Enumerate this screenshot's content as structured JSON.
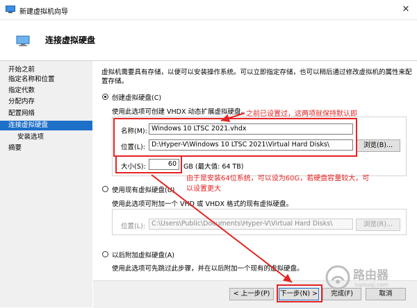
{
  "window": {
    "title": "新建虚拟机向导",
    "close_glyph": "✕"
  },
  "header": {
    "title": "连接虚拟硬盘"
  },
  "sidebar": {
    "items": [
      {
        "label": "开始之前",
        "active": false,
        "sub": false
      },
      {
        "label": "指定名称和位置",
        "active": false,
        "sub": false
      },
      {
        "label": "指定代数",
        "active": false,
        "sub": false
      },
      {
        "label": "分配内存",
        "active": false,
        "sub": false
      },
      {
        "label": "配置网络",
        "active": false,
        "sub": false
      },
      {
        "label": "连接虚拟硬盘",
        "active": true,
        "sub": false
      },
      {
        "label": "安装选项",
        "active": false,
        "sub": true
      },
      {
        "label": "摘要",
        "active": false,
        "sub": false
      }
    ]
  },
  "main": {
    "intro_line1": "虚拟机需要具有存储，以便可以安装操作系统。可以立即指定存储，也可以稍后通过修改虚拟机的属性来配",
    "intro_line2": "置存储。",
    "create_vhd": {
      "label": "创建虚拟硬盘(C)",
      "selected": true,
      "desc": "使用此选项可创建 VHDX 动态扩展虚拟硬盘。",
      "name_label": "名称(M):",
      "name_value": "Windows 10 LTSC 2021.vhdx",
      "location_label": "位置(L):",
      "location_value": "D:\\Hyper-V\\Windows 10 LTSC 2021\\Virtual Hard Disks\\",
      "browse_label": "浏览(B)...",
      "size_label": "大小(S):",
      "size_value": "60",
      "size_unit": "GB (最大值: 64 TB)"
    },
    "existing_vhd": {
      "label": "使用现有虚拟硬盘(U)",
      "selected": false,
      "desc": "使用此选项可附加一个 VHD 或 VHDX 格式的现有虚拟硬盘。",
      "location_label": "位置(L):",
      "location_value": "C:\\Users\\Public\\Documents\\Hyper-V\\Virtual Hard Disks\\",
      "browse_label": "浏览(R)..."
    },
    "later": {
      "label": "以后附加虚拟硬盘(A)",
      "selected": false,
      "desc": "使用此选项可先跳过此步骤，并在以后附加一个现有的虚拟硬盘。"
    }
  },
  "annotations": {
    "note1": "之前已设置过，这两项就保持默认即",
    "note2_line1": "由于是安装64位系统，可以设为60G，若硬盘容量较大，可",
    "note2_line2": "以设置更大"
  },
  "footer": {
    "prev_label": "< 上一步(P)",
    "next_label": "下一步(N) >",
    "finish_label": "完成(F)",
    "cancel_label": "取消"
  },
  "watermark": {
    "text": "路由器",
    "subtext": "luyouqi.com"
  },
  "colors": {
    "accent": "#1e6fc8",
    "annotation_red": "#e62222"
  }
}
